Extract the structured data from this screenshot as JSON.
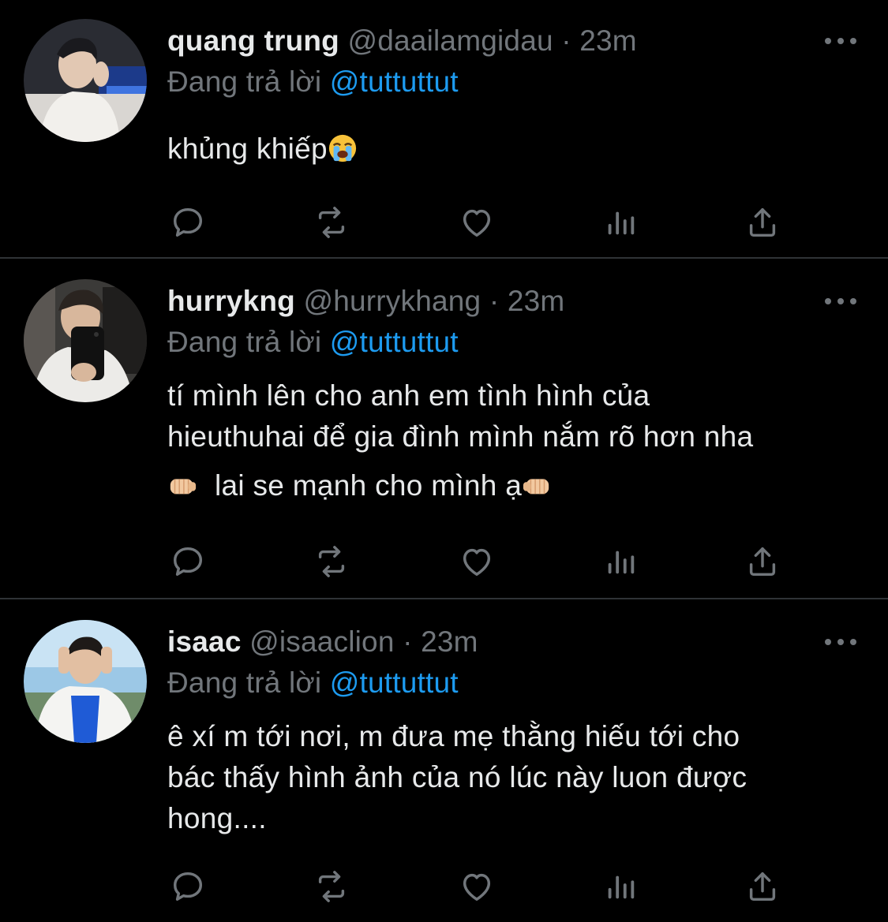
{
  "theme": {
    "background": "#000000",
    "text": "#e7e9ea",
    "muted": "#71767b",
    "accent": "#1d9bf0",
    "divider": "#2f3336"
  },
  "tweets": [
    {
      "name": "quang trung",
      "handle": "@daailamgidau",
      "dot": "·",
      "time": "23m",
      "reply_prefix": "Đang trả lời",
      "reply_to": "@tuttuttut",
      "lines": [
        "khủng khiếp"
      ],
      "emojis": [
        "loudly-crying-face-emoji"
      ],
      "actions": [
        "reply-icon",
        "retweet-icon",
        "like-icon",
        "views-icon",
        "share-icon"
      ]
    },
    {
      "name": "hurrykng",
      "handle": "@hurrykhang",
      "dot": "·",
      "time": "23m",
      "reply_prefix": "Đang trả lời",
      "reply_to": "@tuttuttut",
      "lines": [
        "tí mình lên cho anh em tình hình của",
        "hieuthuhai để gia đình mình nắm rõ hơn nha",
        "lai se mạnh cho mình ạ"
      ],
      "emojis": [
        "oncoming-fist-emoji",
        "oncoming-fist-emoji"
      ],
      "actions": [
        "reply-icon",
        "retweet-icon",
        "like-icon",
        "views-icon",
        "share-icon"
      ]
    },
    {
      "name": "isaac",
      "handle": "@isaaclion",
      "dot": "·",
      "time": "23m",
      "reply_prefix": "Đang trả lời",
      "reply_to": "@tuttuttut",
      "lines": [
        "ê xí m tới nơi, m đưa mẹ thằng hiếu tới cho",
        "bác thấy hình ảnh của nó lúc này luon được",
        "hong...."
      ],
      "emojis": [],
      "actions": [
        "reply-icon",
        "retweet-icon",
        "like-icon",
        "views-icon",
        "share-icon"
      ]
    }
  ]
}
